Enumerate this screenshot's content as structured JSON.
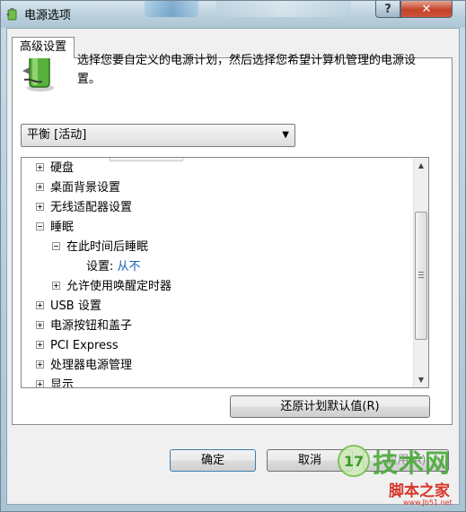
{
  "window": {
    "title": "电源选项",
    "help_label": "?",
    "close_label": "✕"
  },
  "tab": {
    "label": "高级设置"
  },
  "description": "选择您要自定义的电源计划，然后选择您希望计算机管理的电源设置。",
  "plan_select": {
    "value": "平衡 [活动]"
  },
  "tree": {
    "items": [
      {
        "label": "硬盘",
        "expander": "plus"
      },
      {
        "label": "桌面背景设置",
        "expander": "plus"
      },
      {
        "label": "无线适配器设置",
        "expander": "plus"
      },
      {
        "label": "睡眠",
        "expander": "minus"
      },
      {
        "label": "在此时间后睡眠",
        "expander": "minus"
      },
      {
        "label": "设置:",
        "value": "从不"
      },
      {
        "label": "允许使用唤醒定时器",
        "expander": "plus"
      },
      {
        "label": "USB 设置",
        "expander": "plus"
      },
      {
        "label": "电源按钮和盖子",
        "expander": "plus"
      },
      {
        "label": "PCI Express",
        "expander": "plus"
      },
      {
        "label": "处理器电源管理",
        "expander": "plus"
      },
      {
        "label": "显示",
        "expander": "plus"
      }
    ]
  },
  "buttons": {
    "restore": "还原计划默认值(R)",
    "ok": "确定",
    "cancel": "取消",
    "apply": "应用(A)"
  },
  "watermark": {
    "logo_text": "17",
    "text": "技术网",
    "sub": "脚本之家",
    "url": "www.Jb51.net"
  },
  "colors": {
    "setting_value": "#1a5fb4",
    "close_button": "#c4432a",
    "watermark_green": "#4caa3c",
    "watermark_red": "#d8352a"
  }
}
